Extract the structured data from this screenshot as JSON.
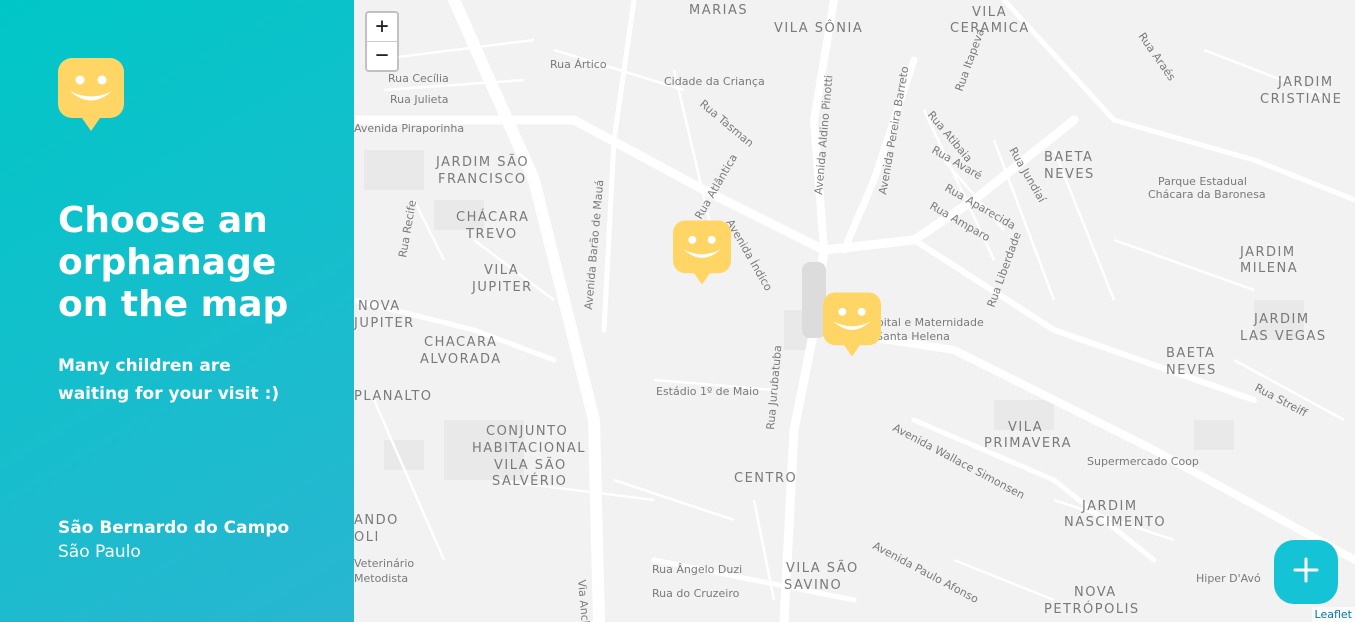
{
  "sidebar": {
    "logo_icon": "smiley-face-logo",
    "title": "Choose an orphanage on the map",
    "subtitle": "Many children are waiting for your visit :)",
    "city": "São Bernardo do Campo",
    "state": "São Paulo"
  },
  "map": {
    "zoom_in": "+",
    "zoom_out": "−",
    "attribution": "Leaflet",
    "labels": [
      "MARIAS",
      "VILA SÔNIA",
      "VILA",
      "CERAMICA",
      "Rua Cecília",
      "Rua Ártico",
      "Cidade da Criança",
      "Rua Julieta",
      "Avenida Piraporinha",
      "Rua Tasman",
      "JARDIM SÃO",
      "FRANCISCO",
      "Avenida Aldino Pinotti",
      "Avenida Pereira Barreto",
      "CHÁCARA",
      "TREVO",
      "VILA",
      "JUPITER",
      "NOVA",
      "JUPITER",
      "CHACARA",
      "ALVORADA",
      "PLANALTO",
      "Rua Atlântica",
      "Avenida Índico",
      "Avenida Barão de Mauá",
      "Rua Recife",
      "Estádio 1º de Maio",
      "Rua Jurubatuba",
      "Hospital e Maternidade",
      "Santa Helena",
      "CONJUNTO",
      "HABITACIONAL",
      "VILA SÃO",
      "SALVÉRIO",
      "CENTRO",
      "BAETA",
      "NEVES",
      "JARDIM",
      "CRISTIANE",
      "Parque Estadual",
      "Chácara da Baronesa",
      "JARDIM",
      "MILENA",
      "JARDIM",
      "LAS VEGAS",
      "BAETA",
      "NEVES",
      "Rua Atibaia",
      "Rua Avaré",
      "Rua Aparecida",
      "Rua Amparo",
      "Rua Jundiaí",
      "Rua Itapeva",
      "Rua Araés",
      "Rua Liberdade",
      "VILA",
      "PRIMAVERA",
      "Avenida Wallace Simonsen",
      "Supermercado Coop",
      "JARDIM",
      "NASCIMENTO",
      "Rua Streiff",
      "ANDO",
      "OLI",
      "Veterinário",
      "Metodista",
      "Rua Ângelo Duzi",
      "Rua do Cruzeiro",
      "VILA SÃO",
      "SAVINO",
      "Avenida Paulo Afonso",
      "Hiper D'Avó",
      "NOVA",
      "PETRÓPOLIS",
      "Via Anchieta"
    ]
  },
  "add_button": {
    "icon": "plus-icon"
  },
  "colors": {
    "sidebar_gradient_start": "#00C7C7",
    "sidebar_gradient_end": "#29B6D1",
    "marker": "#FFD666",
    "add_button": "#15C3D6",
    "map_bg": "#f2f2f2"
  }
}
